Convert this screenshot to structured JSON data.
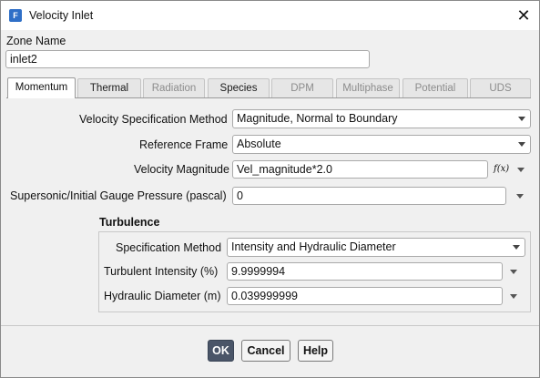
{
  "window": {
    "title": "Velocity Inlet",
    "app_icon_letter": "F"
  },
  "zone": {
    "label": "Zone Name",
    "value": "inlet2"
  },
  "tabs": [
    {
      "label": "Momentum",
      "state": "active"
    },
    {
      "label": "Thermal",
      "state": "enabled"
    },
    {
      "label": "Radiation",
      "state": "disabled"
    },
    {
      "label": "Species",
      "state": "enabled"
    },
    {
      "label": "DPM",
      "state": "disabled"
    },
    {
      "label": "Multiphase",
      "state": "disabled"
    },
    {
      "label": "Potential",
      "state": "disabled"
    },
    {
      "label": "UDS",
      "state": "disabled"
    }
  ],
  "momentum": {
    "velocity_spec": {
      "label": "Velocity Specification Method",
      "value": "Magnitude, Normal to Boundary"
    },
    "reference_frame": {
      "label": "Reference Frame",
      "value": "Absolute"
    },
    "velocity_magnitude": {
      "label": "Velocity Magnitude",
      "value": "Vel_magnitude*2.0",
      "fx": "f(x)"
    },
    "gauge_pressure": {
      "label": "Supersonic/Initial Gauge Pressure (pascal)",
      "value": "0"
    }
  },
  "turbulence": {
    "heading": "Turbulence",
    "spec_method": {
      "label": "Specification Method",
      "value": "Intensity and Hydraulic Diameter"
    },
    "intensity": {
      "label": "Turbulent Intensity (%)",
      "value": "9.9999994"
    },
    "diameter": {
      "label": "Hydraulic Diameter (m)",
      "value": "0.039999999"
    }
  },
  "buttons": {
    "ok": "OK",
    "cancel": "Cancel",
    "help": "Help"
  },
  "colors": {
    "accent": "#2f6fc7",
    "ok_button": "#4a5568"
  }
}
